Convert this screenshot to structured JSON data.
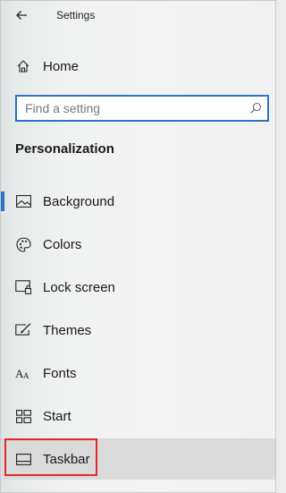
{
  "window": {
    "title": "Settings"
  },
  "nav": {
    "back_icon": "back-arrow-icon",
    "home_label": "Home",
    "home_icon": "home-icon"
  },
  "search": {
    "placeholder": "Find a setting",
    "value": "",
    "icon": "search-icon"
  },
  "section": {
    "title": "Personalization"
  },
  "menu": {
    "items": [
      {
        "label": "Background",
        "icon": "picture-icon",
        "active": true
      },
      {
        "label": "Colors",
        "icon": "palette-icon"
      },
      {
        "label": "Lock screen",
        "icon": "lock-screen-icon"
      },
      {
        "label": "Themes",
        "icon": "themes-brush-icon"
      },
      {
        "label": "Fonts",
        "icon": "fonts-icon"
      },
      {
        "label": "Start",
        "icon": "start-tiles-icon"
      },
      {
        "label": "Taskbar",
        "icon": "taskbar-icon",
        "selected": true
      }
    ]
  },
  "colors": {
    "accent": "#2b73c4",
    "highlight_border": "#e02a2a",
    "selected_bg": "#dadada"
  }
}
